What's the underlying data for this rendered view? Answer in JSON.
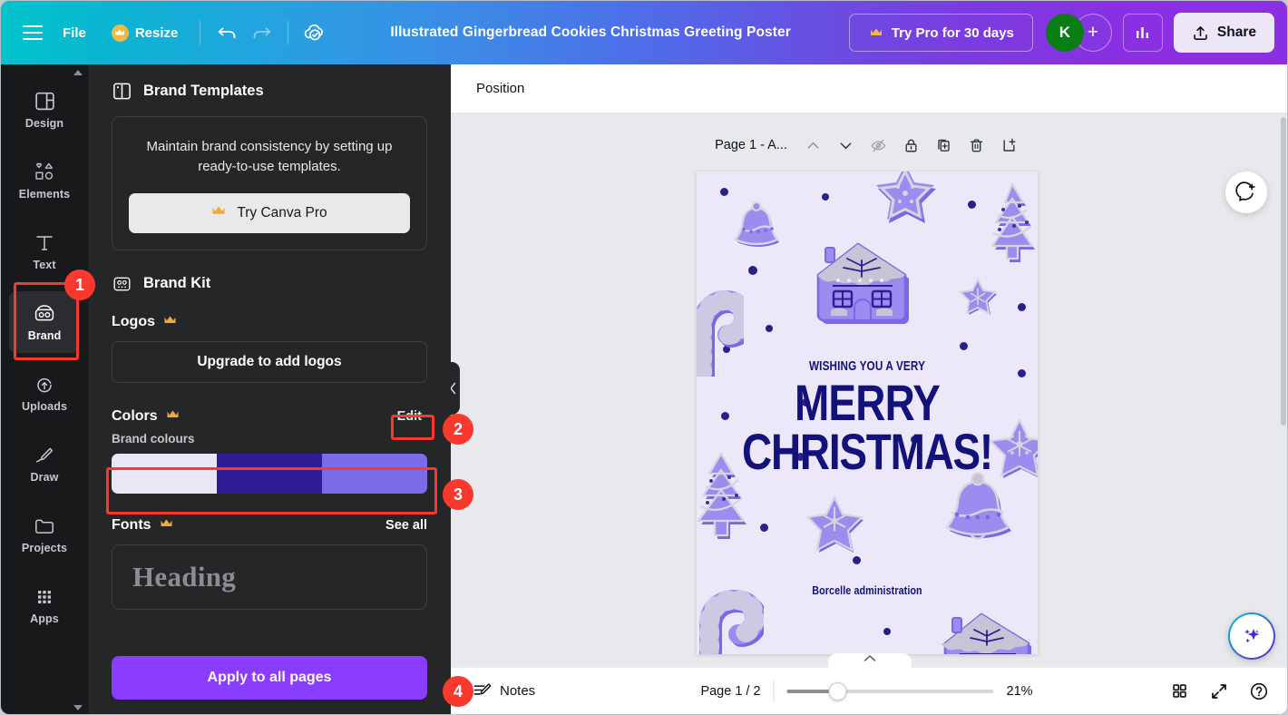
{
  "header": {
    "menu_icon": "hamburger-icon",
    "file_label": "File",
    "resize_label": "Resize",
    "undo_icon": "undo-icon",
    "redo_icon": "redo-icon",
    "cloud_icon": "cloud-saved-icon",
    "doc_title": "Illustrated Gingerbread Cookies Christmas Greeting Poster",
    "try_pro_label": "Try Pro for 30 days",
    "avatar_initial": "K",
    "avatar_add": "+",
    "insights_icon": "insights-bar-chart-icon",
    "share_label": "Share",
    "share_icon": "share-upload-icon",
    "crown": "♛"
  },
  "rail": {
    "items": [
      {
        "label": "Design",
        "icon": "design-layout-icon",
        "active": false
      },
      {
        "label": "Elements",
        "icon": "elements-shapes-icon",
        "active": false
      },
      {
        "label": "Text",
        "icon": "text-t-icon",
        "active": false
      },
      {
        "label": "Brand",
        "icon": "brand-kit-icon",
        "active": true
      },
      {
        "label": "Uploads",
        "icon": "uploads-cloud-icon",
        "active": false
      },
      {
        "label": "Draw",
        "icon": "draw-pen-icon",
        "active": false
      },
      {
        "label": "Projects",
        "icon": "projects-folder-icon",
        "active": false
      },
      {
        "label": "Apps",
        "icon": "apps-grid-icon",
        "active": false
      }
    ]
  },
  "panel": {
    "brand_templates": {
      "title": "Brand Templates",
      "icon": "brand-templates-icon",
      "description": "Maintain brand consistency by setting up ready-to-use templates.",
      "cta_label": "Try Canva Pro"
    },
    "brand_kit": {
      "title": "Brand Kit",
      "icon": "brand-kit-icon"
    },
    "logos": {
      "title": "Logos",
      "upgrade_label": "Upgrade to add logos"
    },
    "colors": {
      "title": "Colors",
      "edit_label": "Edit",
      "group_label": "Brand colours",
      "swatches": [
        "#EAE6F8",
        "#2E1D94",
        "#7C6BE8"
      ]
    },
    "fonts": {
      "title": "Fonts",
      "see_all_label": "See all",
      "heading_sample": "Heading"
    },
    "apply_label": "Apply to all pages",
    "collapse_icon": "chevron-left-icon"
  },
  "canvas": {
    "position_label": "Position",
    "page_name": "Page 1 - A...",
    "toolbar_icons": [
      "chevron-up-icon",
      "chevron-down-icon",
      "hide-page-icon",
      "lock-icon",
      "duplicate-page-icon",
      "delete-page-icon",
      "add-page-icon"
    ],
    "comment_icon": "add-comment-icon",
    "magic_icon": "magic-studio-sparkle-icon",
    "poster": {
      "background": "#ECE8FA",
      "ink": "#13117A",
      "cookie_fill": "#9B8CF0",
      "cookie_shadow": "#7A69E4",
      "icing": "#D7D4E0",
      "line1": "WISHING YOU A VERY",
      "line2": "MERRY",
      "line3": "CHRISTMAS!",
      "footer": "Borcelle administration"
    }
  },
  "bottom": {
    "notes_label": "Notes",
    "notes_icon": "notes-icon",
    "page_count": "Page 1 / 2",
    "zoom_value": "21%",
    "grid_icon": "grid-view-icon",
    "fullscreen_icon": "fullscreen-icon",
    "help_icon": "help-question-icon",
    "expand_icon": "chevron-up-icon"
  },
  "annotations": [
    {
      "number": "1",
      "target": "rail-item-brand"
    },
    {
      "number": "2",
      "target": "colors-edit-link"
    },
    {
      "number": "3",
      "target": "brand-colour-swatches"
    },
    {
      "number": "4",
      "target": "apply-to-all-pages-button"
    }
  ]
}
